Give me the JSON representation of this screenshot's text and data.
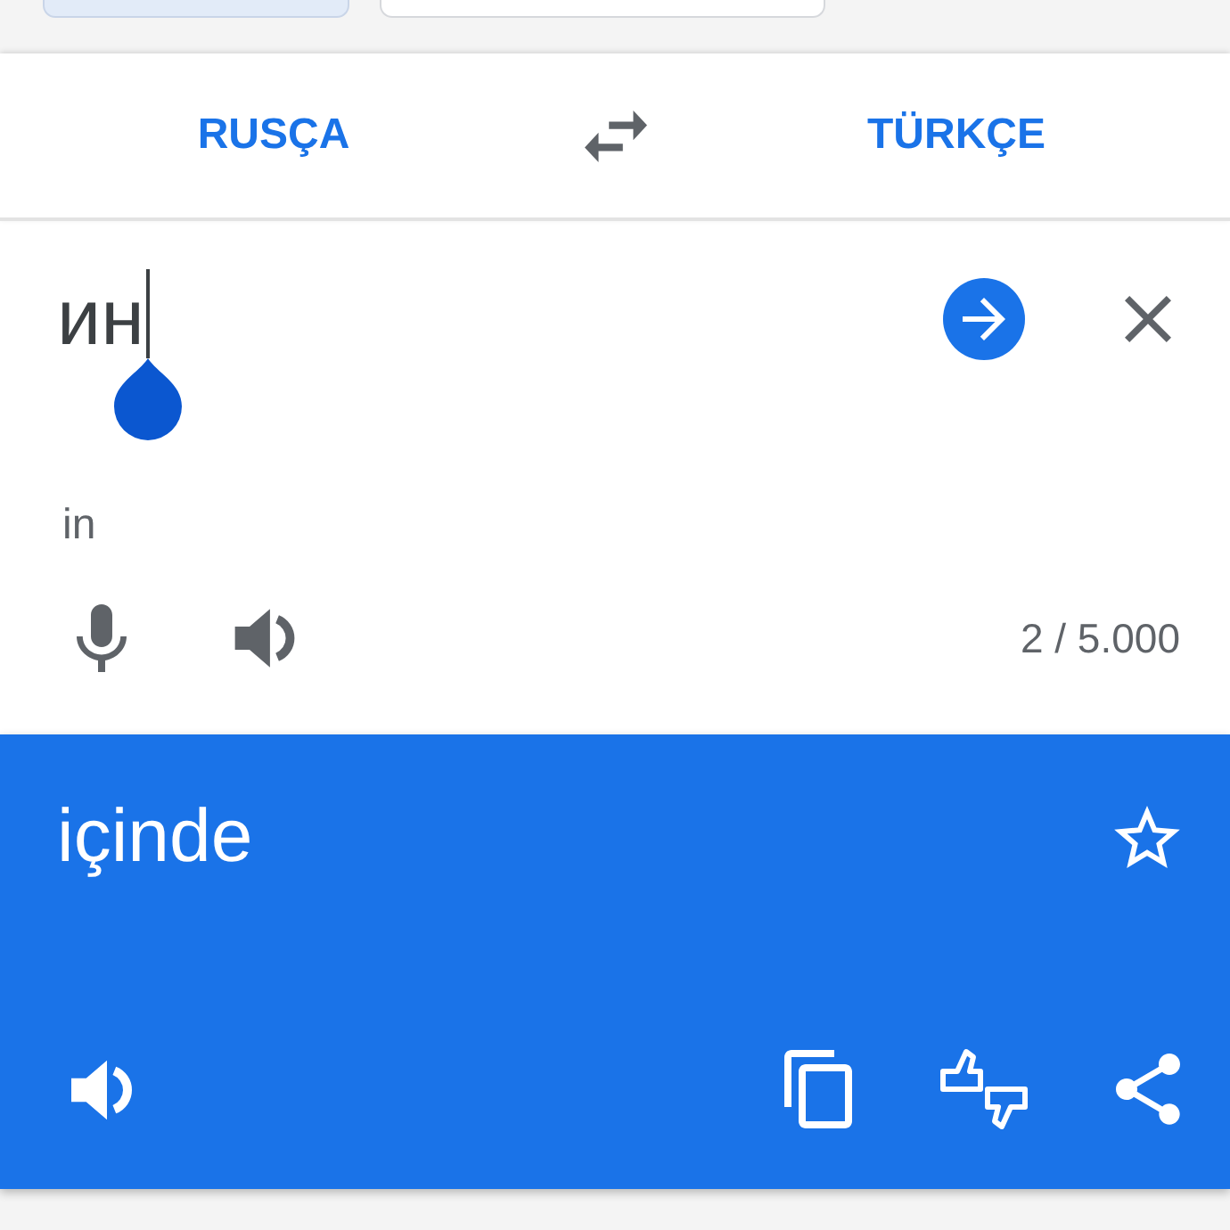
{
  "top_chips": [
    {
      "selected": true
    },
    {
      "selected": false
    }
  ],
  "language_bar": {
    "source": "RUSÇA",
    "target": "TÜRKÇE"
  },
  "input": {
    "value": "ин",
    "transliteration": "in",
    "char_count": "2 / 5.000"
  },
  "output": {
    "text": "içinde"
  }
}
